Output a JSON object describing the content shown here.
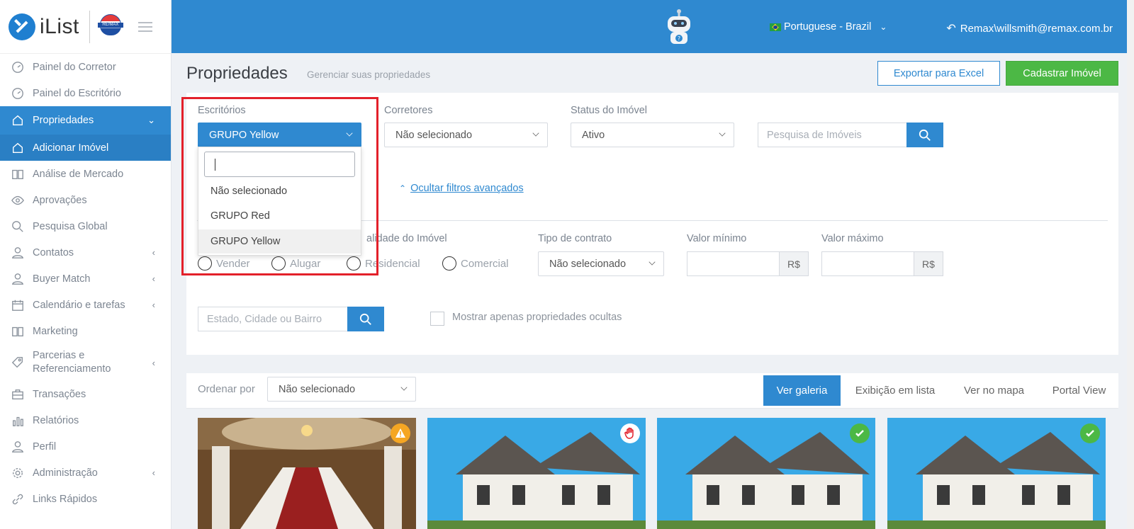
{
  "app": {
    "logo_text": "iList",
    "brand_mark": "RE/MAX"
  },
  "header": {
    "language": "Portuguese - Brazil",
    "user": "Remax\\willsmith@remax.com.br"
  },
  "sidebar": {
    "items": [
      {
        "label": "Painel do Corretor",
        "icon": "gauge-icon"
      },
      {
        "label": "Painel do Escritório",
        "icon": "gauge-icon"
      },
      {
        "label": "Propriedades",
        "icon": "home-icon"
      },
      {
        "label": "Adicionar Imóvel",
        "icon": "home-icon"
      },
      {
        "label": "Análise de Mercado",
        "icon": "book-icon"
      },
      {
        "label": "Aprovações",
        "icon": "eye-icon"
      },
      {
        "label": "Pesquisa Global",
        "icon": "search-icon"
      },
      {
        "label": "Contatos",
        "icon": "user-icon"
      },
      {
        "label": "Buyer Match",
        "icon": "user-icon"
      },
      {
        "label": "Calendário e tarefas",
        "icon": "calendar-icon"
      },
      {
        "label": "Marketing",
        "icon": "book-icon"
      },
      {
        "label": "Parcerias e Referenciamento",
        "icon": "tag-icon"
      },
      {
        "label": "Transações",
        "icon": "briefcase-icon"
      },
      {
        "label": "Relatórios",
        "icon": "bar-chart-icon"
      },
      {
        "label": "Perfil",
        "icon": "user-icon"
      },
      {
        "label": "Administração",
        "icon": "gear-icon"
      },
      {
        "label": "Links Rápidos",
        "icon": "link-icon"
      }
    ]
  },
  "page": {
    "title": "Propriedades",
    "subtitle": "Gerenciar suas propriedades",
    "export_label": "Exportar para Excel",
    "add_label": "Cadastrar Imóvel"
  },
  "filters": {
    "offices_label": "Escritórios",
    "offices_value": "GRUPO Yellow",
    "brokers_label": "Corretores",
    "brokers_value": "Não selecionado",
    "status_label": "Status do Imóvel",
    "status_value": "Ativo",
    "search_placeholder": "Pesquisa de Imóveis",
    "advanced_link": "Ocultar filtros avançados",
    "purpose_label_partial": "alidade do Imóvel",
    "radio_sell": "Vender",
    "radio_rent": "Alugar",
    "radio_residential": "Residencial",
    "radio_commercial": "Comercial",
    "contract_label": "Tipo de contrato",
    "contract_value": "Não selecionado",
    "min_label": "Valor mínimo",
    "max_label": "Valor máximo",
    "currency": "R$",
    "location_placeholder": "Estado, Cidade ou Bairro",
    "hidden_only_label": "Mostrar apenas propriedades ocultas"
  },
  "dropdown": {
    "options": [
      "Não selecionado",
      "GRUPO Red",
      "GRUPO Yellow"
    ],
    "highlighted": "GRUPO Yellow"
  },
  "results": {
    "sort_label": "Ordenar por",
    "sort_value": "Não selecionado",
    "views": [
      "Ver galeria",
      "Exibição em lista",
      "Ver no mapa",
      "Portal View"
    ],
    "active_view": "Ver galeria"
  },
  "cards": [
    {
      "image": "interior-staircase",
      "status_icon": "warning-icon"
    },
    {
      "image": "house-exterior",
      "status_icon": "hand-stop-icon"
    },
    {
      "image": "house-exterior",
      "status_icon": "check-icon"
    },
    {
      "image": "house-exterior",
      "status_icon": "check-icon"
    }
  ],
  "colors": {
    "primary": "#2f89d0",
    "success": "#4cb845",
    "highlight": "#e3202a",
    "warning": "#f5a623"
  }
}
